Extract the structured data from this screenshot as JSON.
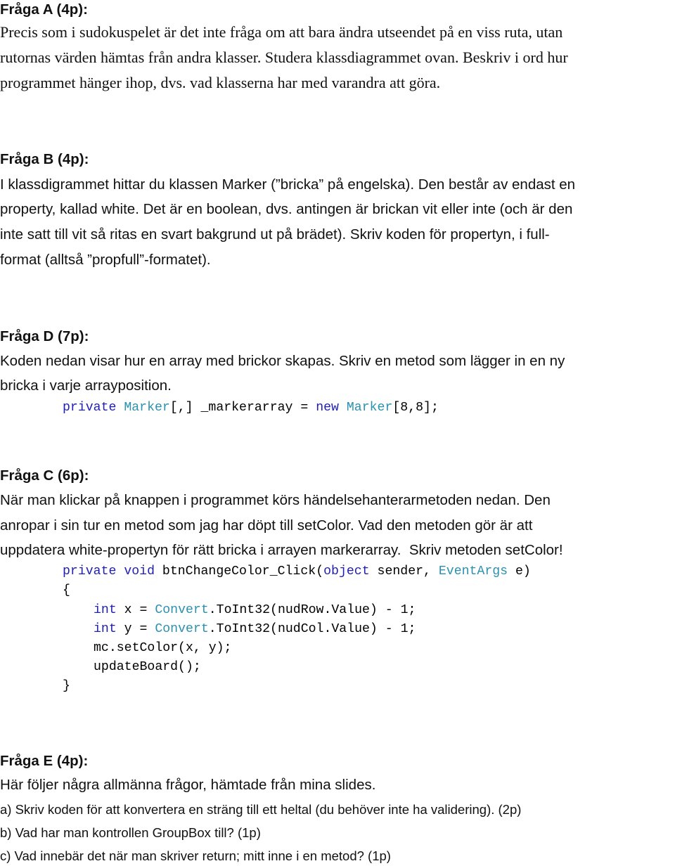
{
  "questions": {
    "A": {
      "heading": "Fråga A (4p):",
      "lines": [
        "Precis som i sudokuspelet är det inte fråga om att bara ändra utseendet på en viss ruta, utan",
        "rutornas värden hämtas från andra klasser. Studera klassdiagrammet ovan. Beskriv i ord hur",
        "programmet hänger ihop, dvs. vad klasserna har med varandra att göra."
      ]
    },
    "B": {
      "heading": "Fråga B (4p):",
      "lines": [
        "I klassdigrammet hittar du klassen Marker (”bricka” på engelska). Den består av endast en",
        "property, kallad white. Det är en boolean, dvs. antingen är brickan vit eller inte (och är den",
        "inte satt till vit så ritas en svart bakgrund ut på brädet). Skriv koden för propertyn, i full-",
        "format (alltså ”propfull”-formatet)."
      ]
    },
    "D": {
      "heading": "Fråga D (7p):",
      "lines": [
        "Koden nedan visar hur en array med brickor skapas. Skriv en metod som lägger in en ny",
        "bricka i varje arrayposition."
      ],
      "code": {
        "kw_private": "private",
        "type_marker": "Marker",
        "decl": "[,] _markerarray = ",
        "kw_new": "new",
        "type_marker2": "Marker",
        "size": "[8,8];"
      }
    },
    "C": {
      "heading": "Fråga C (6p):",
      "lines": [
        "När man klickar på knappen i programmet körs händelsehanterarmetoden nedan. Den",
        "anropar i sin tur en metod som jag har döpt till setColor. Vad den metoden gör är att",
        "uppdatera white-propertyn för rätt bricka i arrayen markerarray.  Skriv metoden setColor!"
      ],
      "code": {
        "line1": {
          "kw_private": "private",
          "kw_void": "void",
          "name": " btnChangeColor_Click(",
          "kw_object": "object",
          "param1": " sender, ",
          "type_eventargs": "EventArgs",
          "param2": " e)"
        },
        "open_brace": "{",
        "line3": {
          "kw_int": "int",
          "var": " x = ",
          "type_convert": "Convert",
          "rest": ".ToInt32(nudRow.Value) - 1;"
        },
        "line4": {
          "kw_int": "int",
          "var": " y = ",
          "type_convert": "Convert",
          "rest": ".ToInt32(nudCol.Value) - 1;"
        },
        "line5": "mc.setColor(x, y);",
        "line6": "updateBoard();",
        "close_brace": "}"
      }
    },
    "E": {
      "heading": "Fråga E (4p):",
      "intro": "Här följer några allmänna frågor, hämtade från mina slides.",
      "items": [
        "a) Skriv koden för att konvertera en sträng till ett heltal (du behöver inte ha validering). (2p)",
        "b) Vad har man kontrollen GroupBox till? (1p)",
        "c) Vad innebär det när man skriver return; mitt inne i en metod? (1p)"
      ]
    }
  },
  "colors": {
    "keyword": "#0000ff",
    "type": "#2b91af",
    "text": "#000000"
  }
}
